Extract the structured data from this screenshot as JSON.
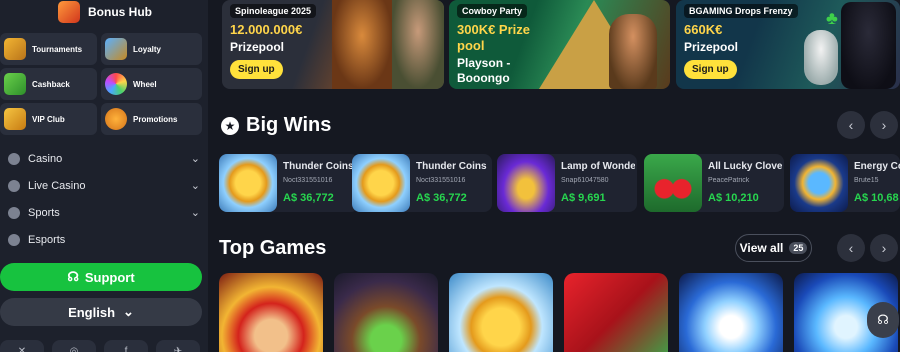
{
  "sidebar": {
    "bonus_hub": "Bonus Hub",
    "tiles": [
      {
        "label": "Tournaments",
        "icon": "trophy-icon"
      },
      {
        "label": "Loyalty",
        "icon": "shield-icon"
      },
      {
        "label": "Cashback",
        "icon": "cashback-icon"
      },
      {
        "label": "Wheel",
        "icon": "wheel-icon"
      },
      {
        "label": "VIP Club",
        "icon": "crown-icon"
      },
      {
        "label": "Promotions",
        "icon": "percent-icon"
      }
    ],
    "nav": [
      {
        "label": "Casino",
        "icon": "dice-icon",
        "chevron": "⌄"
      },
      {
        "label": "Live Casino",
        "icon": "live-icon",
        "chevron": "⌄"
      },
      {
        "label": "Sports",
        "icon": "ball-icon",
        "chevron": "⌄"
      },
      {
        "label": "Esports",
        "icon": "gamepad-icon",
        "chevron": ""
      }
    ],
    "support_label": "Support",
    "language": "English",
    "social": [
      "✕",
      "◎",
      "f",
      "✈"
    ]
  },
  "banners": [
    {
      "tag": "Spinoleague 2025",
      "prize": "12.000.000€",
      "sub": "Prizepool",
      "cta": "Sign up"
    },
    {
      "tag": "Cowboy Party",
      "prize": "300K€ Prize pool",
      "sub": "Playson - Booongo",
      "cta": ""
    },
    {
      "tag": "BGAMING Drops Frenzy",
      "prize": "660K€",
      "sub": "Prizepool",
      "cta": "Sign up"
    }
  ],
  "big_wins": {
    "title": "Big Wins",
    "items": [
      {
        "game": "Thunder Coins",
        "player": "Noct331551016",
        "amount": "A$ 36,772"
      },
      {
        "game": "Thunder Coins",
        "player": "Noct331551016",
        "amount": "A$ 36,772"
      },
      {
        "game": "Lamp of Wonders",
        "player": "Snap61047580",
        "amount": "A$ 9,691"
      },
      {
        "game": "All Lucky Clover",
        "player": "PeacePatrick",
        "amount": "A$ 10,210"
      },
      {
        "game": "Energy Coins",
        "player": "Brute15",
        "amount": "A$ 10,68"
      }
    ]
  },
  "top_games": {
    "title": "Top Games",
    "view_all": "View all",
    "count": "25"
  },
  "arrows": {
    "prev": "‹",
    "next": "›"
  },
  "colors": {
    "accent_green": "#17c23f",
    "win_green": "#27d64f",
    "signup_yellow": "#ffe13b"
  }
}
